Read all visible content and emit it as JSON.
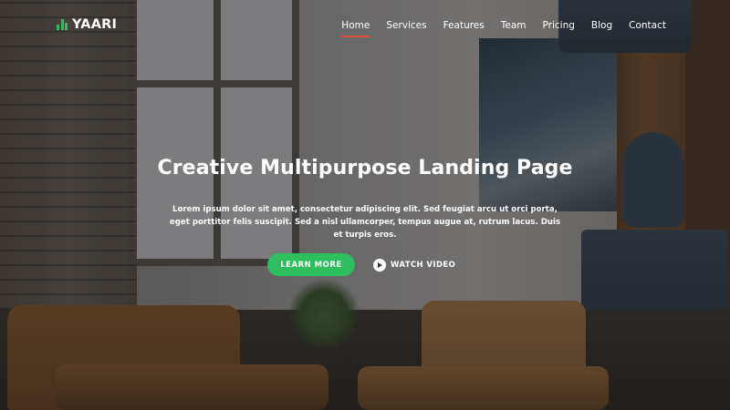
{
  "brand": {
    "name": "YAARI",
    "icon": "bar-chart-icon",
    "accent_color": "#2ebd5f"
  },
  "nav": {
    "items": [
      {
        "label": "Home",
        "active": true
      },
      {
        "label": "Services"
      },
      {
        "label": "Features"
      },
      {
        "label": "Team"
      },
      {
        "label": "Pricing"
      },
      {
        "label": "Blog"
      },
      {
        "label": "Contact"
      }
    ],
    "active_underline_color": "#e04b3c"
  },
  "hero": {
    "title": "Creative Multipurpose Landing Page",
    "description": "Lorem ipsum dolor sit amet, consectetur adipiscing elit. Sed feugiat arcu ut orci porta, eget porttitor felis suscipit. Sed a nisl ullamcorper, tempus augue at, rutrum lacus. Duis et turpis eros.",
    "primary_button": "LEARN MORE",
    "primary_button_color": "#2ebd5f",
    "secondary_button": "WATCH VIDEO",
    "secondary_icon": "play-circle-icon"
  }
}
